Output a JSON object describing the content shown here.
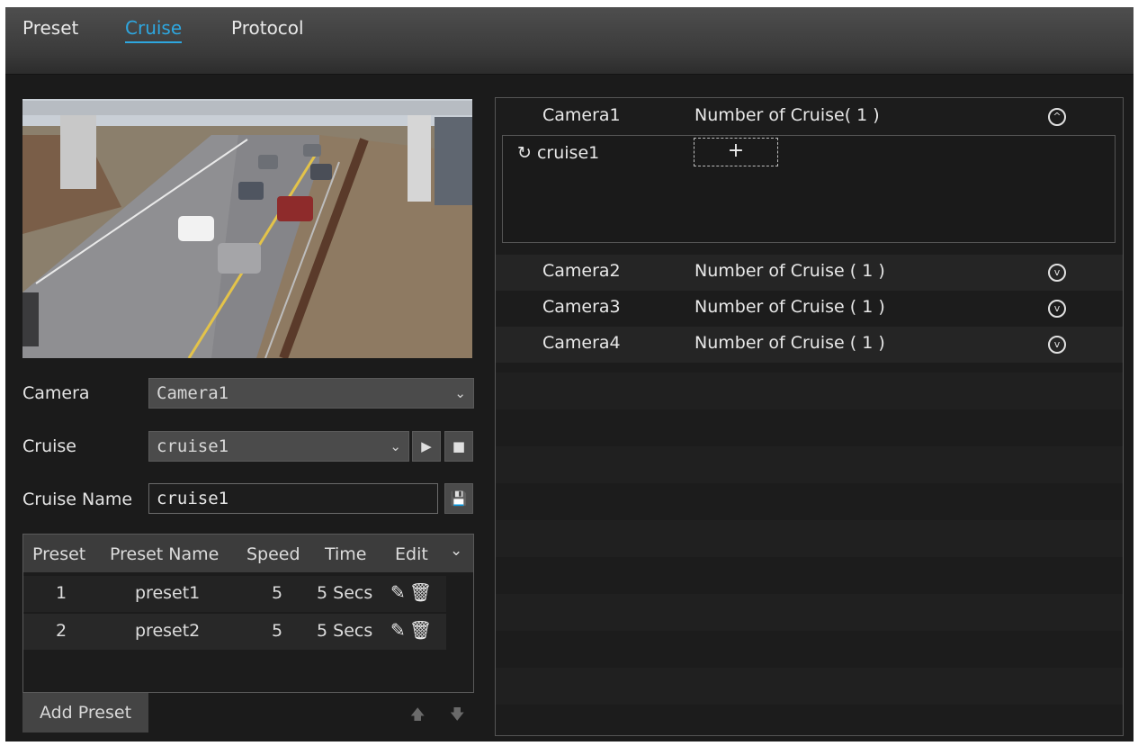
{
  "tabs": [
    {
      "label": "Preset",
      "active": false
    },
    {
      "label": "Cruise",
      "active": true
    },
    {
      "label": "Protocol",
      "active": false
    }
  ],
  "accent_color": "#2ea7e0",
  "form": {
    "camera_label": "Camera",
    "camera_value": "Camera1",
    "cruise_label": "Cruise",
    "cruise_value": "cruise1",
    "cruise_name_label": "Cruise Name",
    "cruise_name_value": "cruise1"
  },
  "preset_table": {
    "headers": [
      "Preset",
      "Preset Name",
      "Speed",
      "Time",
      "Edit"
    ],
    "rows": [
      {
        "preset": "1",
        "name": "preset1",
        "speed": "5",
        "time": "5 Secs"
      },
      {
        "preset": "2",
        "name": "preset2",
        "speed": "5",
        "time": "5 Secs"
      }
    ]
  },
  "add_preset_label": "Add Preset",
  "cameras": [
    {
      "name": "Camera1",
      "cruise_count": "Number of Cruise( 1 )",
      "expanded": true,
      "cruises": [
        "cruise1"
      ]
    },
    {
      "name": "Camera2",
      "cruise_count": "Number of Cruise ( 1 )",
      "expanded": false
    },
    {
      "name": "Camera3",
      "cruise_count": "Number of Cruise ( 1 )",
      "expanded": false
    },
    {
      "name": "Camera4",
      "cruise_count": "Number of Cruise ( 1 )",
      "expanded": false
    }
  ]
}
